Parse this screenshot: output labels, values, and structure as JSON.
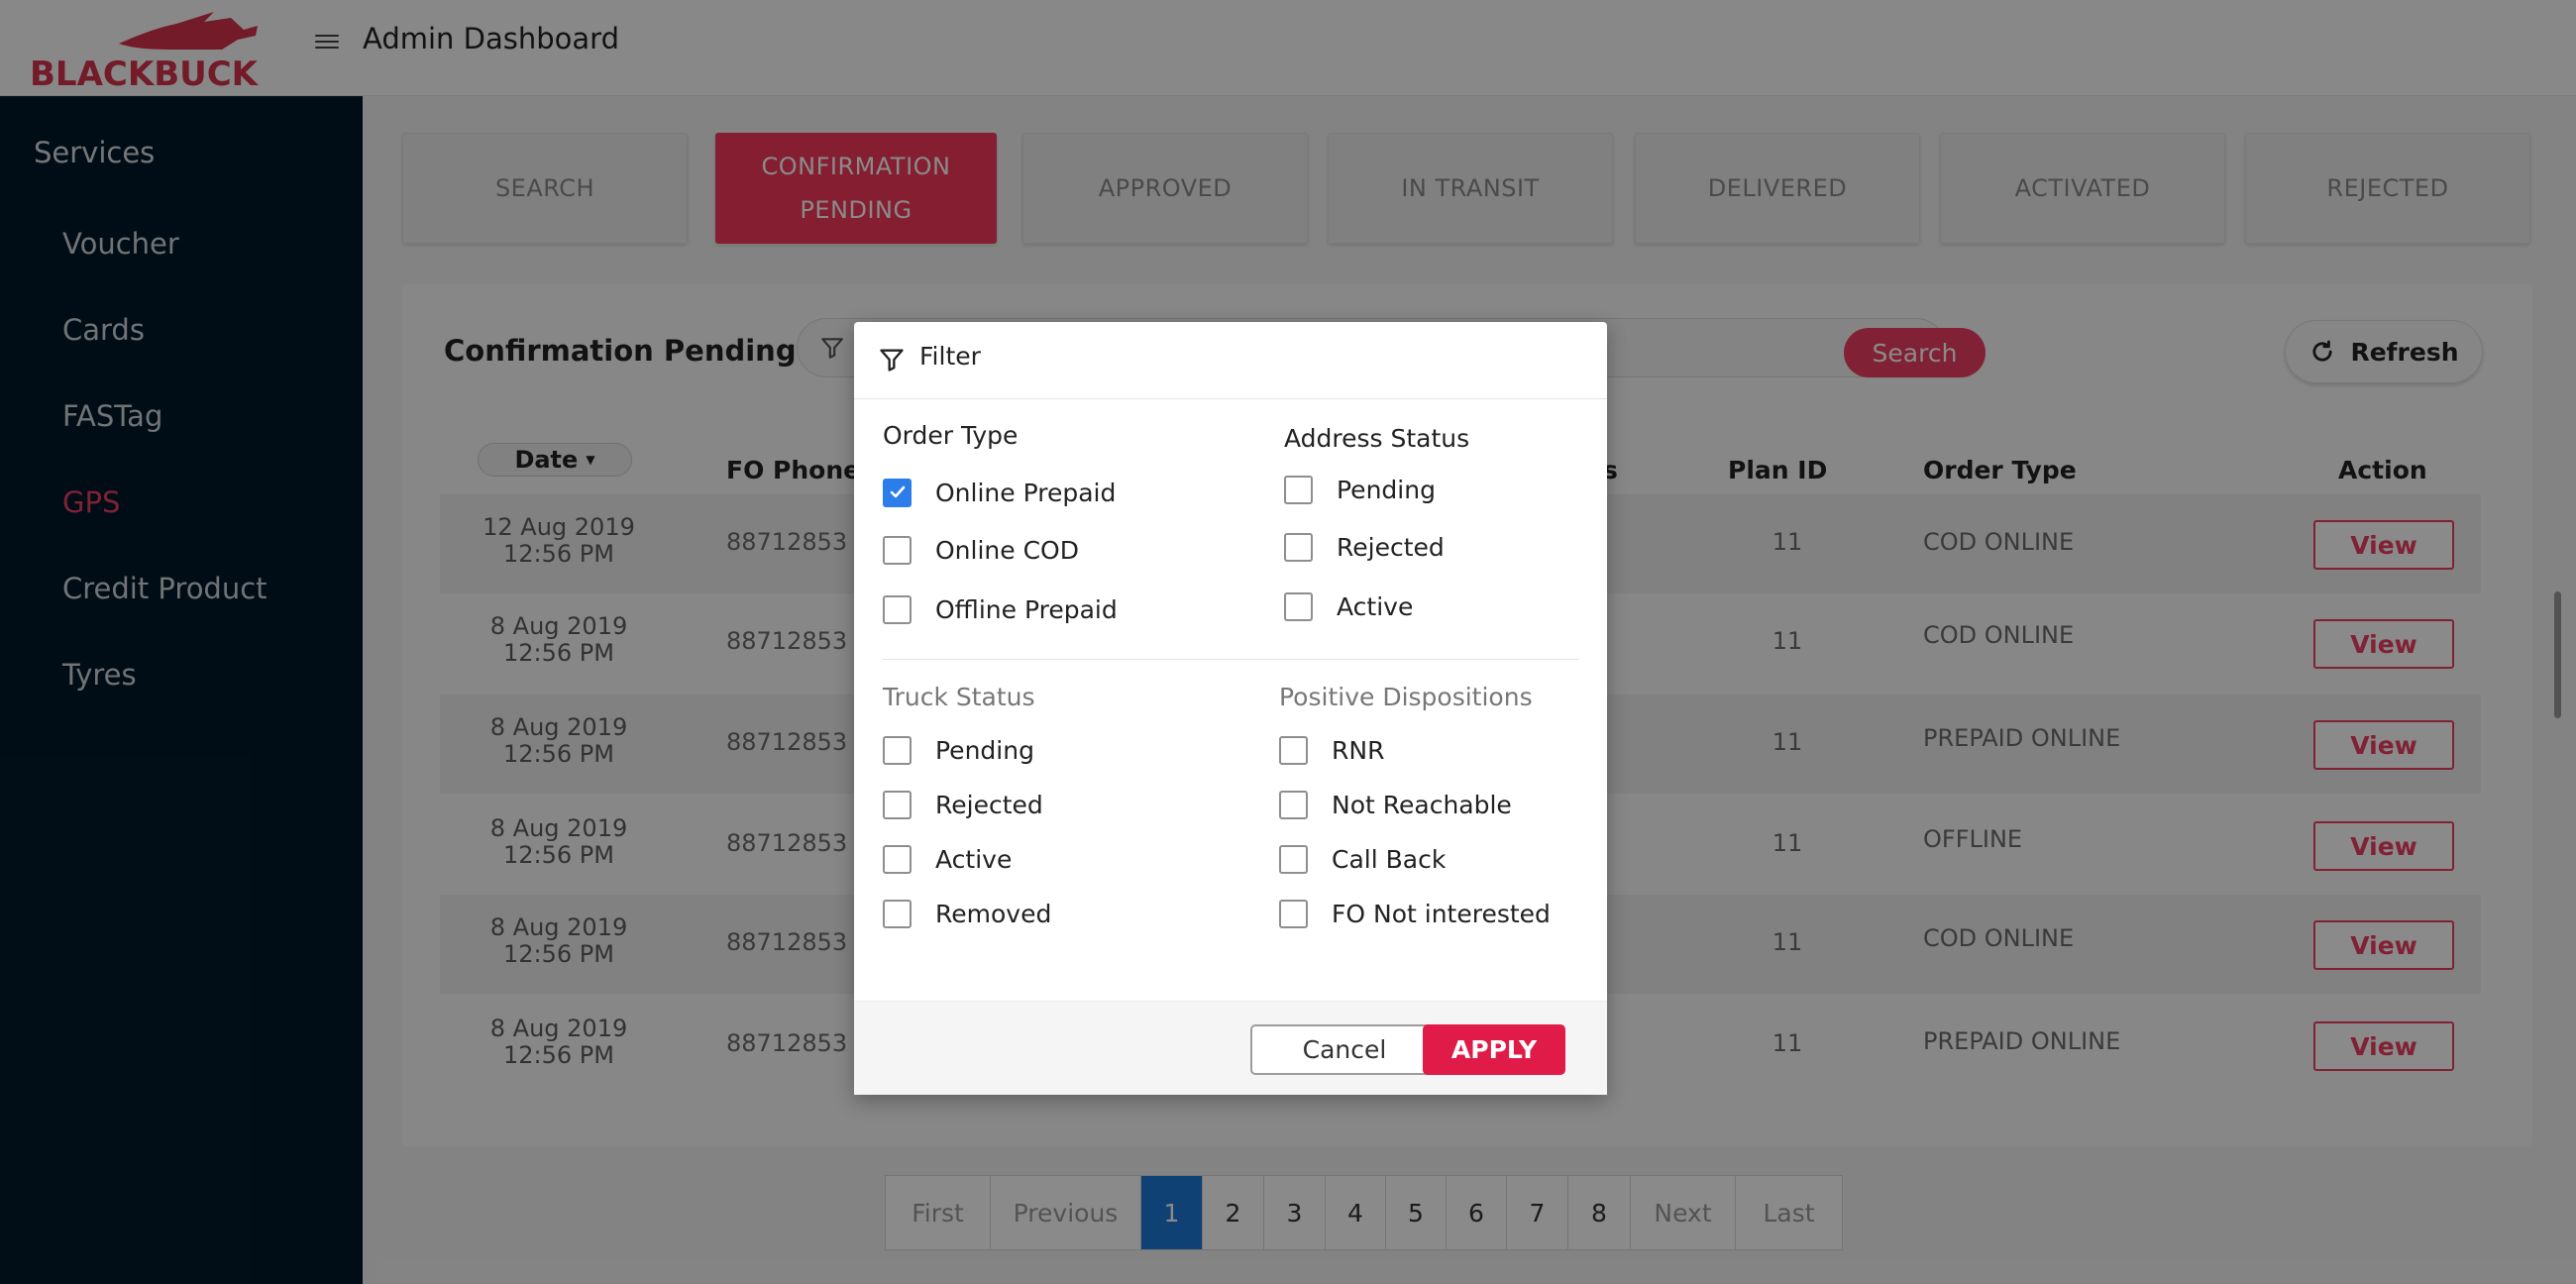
{
  "header": {
    "brand": "BLACKBUCK",
    "title": "Admin Dashboard"
  },
  "sidebar": {
    "heading": "Services",
    "items": [
      {
        "label": "Voucher"
      },
      {
        "label": "Cards"
      },
      {
        "label": "FASTag"
      },
      {
        "label": "GPS",
        "active": true
      },
      {
        "label": "Credit Product"
      },
      {
        "label": "Tyres"
      }
    ]
  },
  "tabs": [
    {
      "label": "SEARCH"
    },
    {
      "label": "CONFIRMATION PENDING",
      "active": true
    },
    {
      "label": "APPROVED"
    },
    {
      "label": "IN TRANSIT"
    },
    {
      "label": "DELIVERED"
    },
    {
      "label": "ACTIVATED"
    },
    {
      "label": "REJECTED"
    }
  ],
  "panel": {
    "title": "Confirmation Pending",
    "search_label": "Search",
    "refresh_label": "Refresh",
    "columns": {
      "date": "Date",
      "fo_phone": "FO Phone N",
      "status_tail": "s",
      "plan_id": "Plan ID",
      "order_type": "Order Type",
      "action": "Action"
    },
    "rows": [
      {
        "date": "12 Aug 2019",
        "time": "12:56 PM",
        "phone": "88712853",
        "plan": "11",
        "order_type": "COD ONLINE",
        "action": "View"
      },
      {
        "date": "8 Aug 2019",
        "time": "12:56 PM",
        "phone": "88712853",
        "plan": "11",
        "order_type": "COD ONLINE",
        "action": "View"
      },
      {
        "date": "8 Aug 2019",
        "time": "12:56 PM",
        "phone": "88712853",
        "plan": "11",
        "order_type": "PREPAID ONLINE",
        "action": "View"
      },
      {
        "date": "8 Aug 2019",
        "time": "12:56 PM",
        "phone": "88712853",
        "plan": "11",
        "order_type": "OFFLINE",
        "action": "View"
      },
      {
        "date": "8 Aug 2019",
        "time": "12:56 PM",
        "phone": "88712853",
        "plan": "11",
        "order_type": "COD ONLINE",
        "action": "View"
      },
      {
        "date": "8 Aug 2019",
        "time": "12:56 PM",
        "phone": "88712853",
        "plan": "11",
        "order_type": "PREPAID ONLINE",
        "action": "View"
      }
    ]
  },
  "pagination": {
    "first": "First",
    "previous": "Previous",
    "pages": [
      "1",
      "2",
      "3",
      "4",
      "5",
      "6",
      "7",
      "8"
    ],
    "current": "1",
    "next": "Next",
    "last": "Last"
  },
  "filter_modal": {
    "title": "Filter",
    "order_type": {
      "title": "Order Type",
      "options": [
        {
          "label": "Online Prepaid",
          "checked": true
        },
        {
          "label": "Online COD",
          "checked": false
        },
        {
          "label": "Offline Prepaid",
          "checked": false
        }
      ]
    },
    "address_status": {
      "title": "Address Status",
      "options": [
        {
          "label": "Pending",
          "checked": false
        },
        {
          "label": "Rejected",
          "checked": false
        },
        {
          "label": "Active",
          "checked": false
        }
      ]
    },
    "truck_status": {
      "title": "Truck Status",
      "options": [
        {
          "label": "Pending",
          "checked": false
        },
        {
          "label": "Rejected",
          "checked": false
        },
        {
          "label": "Active",
          "checked": false
        },
        {
          "label": "Removed",
          "checked": false
        }
      ]
    },
    "positive_dispositions": {
      "title": "Positive Dispositions",
      "options": [
        {
          "label": "RNR",
          "checked": false
        },
        {
          "label": "Not Reachable",
          "checked": false
        },
        {
          "label": "Call Back",
          "checked": false
        },
        {
          "label": "FO Not interested",
          "checked": false
        }
      ]
    },
    "cancel_label": "Cancel",
    "apply_label": "APPLY"
  },
  "colors": {
    "accent": "#ee3d62",
    "sidebar": "#03192a",
    "checkbox": "#2b7de9",
    "page_current": "#1e78d6"
  }
}
